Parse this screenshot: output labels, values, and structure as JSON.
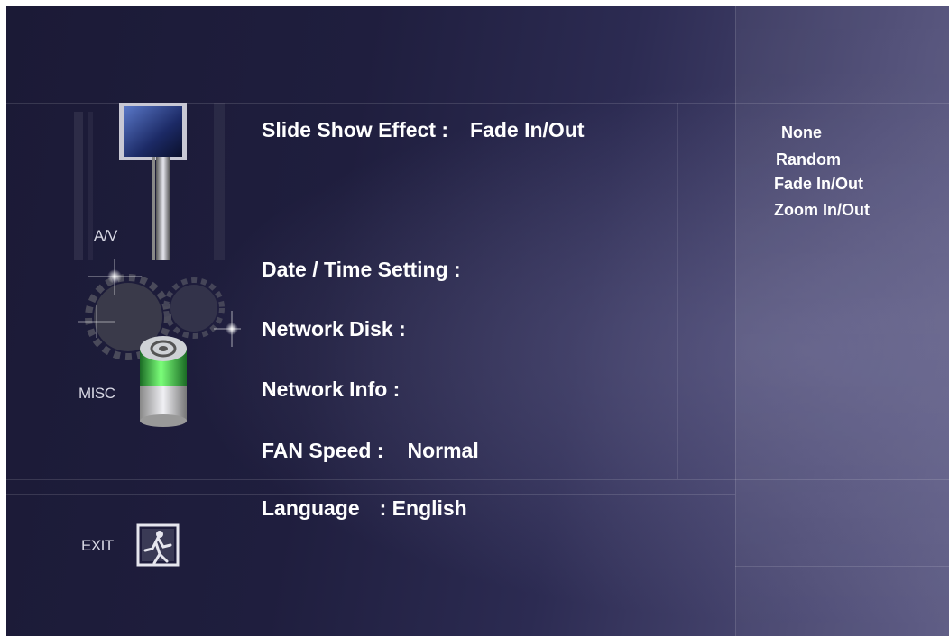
{
  "sidebar": {
    "av_label": "A/V",
    "misc_label": "MISC",
    "exit_label": "EXIT"
  },
  "settings": [
    {
      "label": "Slide Show Effect :",
      "value": "Fade In/Out"
    },
    {
      "label": "Date / Time Setting :",
      "value": ""
    },
    {
      "label": "Network Disk :",
      "value": ""
    },
    {
      "label": "Network Info :",
      "value": ""
    },
    {
      "label": "FAN Speed :",
      "value": "Normal"
    },
    {
      "label": "Language",
      "value": ": English"
    }
  ],
  "options": [
    "None",
    "Random",
    "Fade In/Out",
    "Zoom In/Out"
  ],
  "colors": {
    "accent_green": "#3fe05a",
    "background": "#1f1e3e"
  }
}
